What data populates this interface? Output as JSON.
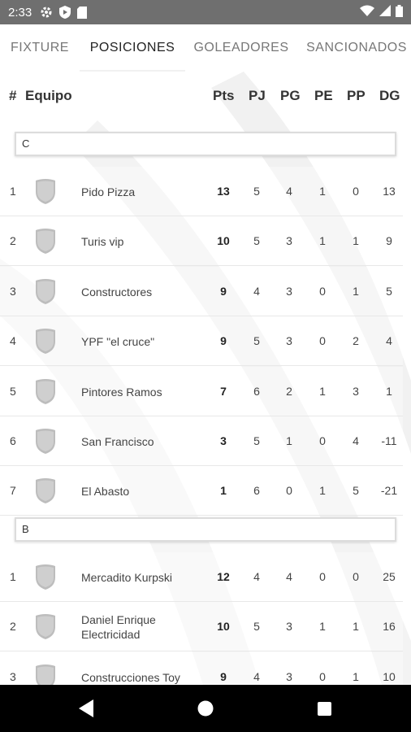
{
  "status": {
    "time": "2:33"
  },
  "tabs": [
    "FIXTURE",
    "POSICIONES",
    "GOLEADORES",
    "SANCIONADOS"
  ],
  "columns": {
    "rank": "#",
    "team": "Equipo",
    "pts": "Pts",
    "pj": "PJ",
    "pg": "PG",
    "pe": "PE",
    "pp": "PP",
    "dg": "DG"
  },
  "groups": [
    {
      "name": "C",
      "rows": [
        {
          "pos": "1",
          "team": "Pido Pizza",
          "pts": "13",
          "pj": "5",
          "pg": "4",
          "pe": "1",
          "pp": "0",
          "dg": "13"
        },
        {
          "pos": "2",
          "team": "Turis vip",
          "pts": "10",
          "pj": "5",
          "pg": "3",
          "pe": "1",
          "pp": "1",
          "dg": "9"
        },
        {
          "pos": "3",
          "team": "Constructores",
          "pts": "9",
          "pj": "4",
          "pg": "3",
          "pe": "0",
          "pp": "1",
          "dg": "5"
        },
        {
          "pos": "4",
          "team": "YPF \"el cruce\"",
          "pts": "9",
          "pj": "5",
          "pg": "3",
          "pe": "0",
          "pp": "2",
          "dg": "4"
        },
        {
          "pos": "5",
          "team": "Pintores Ramos",
          "pts": "7",
          "pj": "6",
          "pg": "2",
          "pe": "1",
          "pp": "3",
          "dg": "1"
        },
        {
          "pos": "6",
          "team": "San Francisco",
          "pts": "3",
          "pj": "5",
          "pg": "1",
          "pe": "0",
          "pp": "4",
          "dg": "-11"
        },
        {
          "pos": "7",
          "team": "El Abasto",
          "pts": "1",
          "pj": "6",
          "pg": "0",
          "pe": "1",
          "pp": "5",
          "dg": "-21"
        }
      ]
    },
    {
      "name": "B",
      "rows": [
        {
          "pos": "1",
          "team": "Mercadito Kurpski",
          "pts": "12",
          "pj": "4",
          "pg": "4",
          "pe": "0",
          "pp": "0",
          "dg": "25"
        },
        {
          "pos": "2",
          "team": "Daniel Enrique Electricidad",
          "pts": "10",
          "pj": "5",
          "pg": "3",
          "pe": "1",
          "pp": "1",
          "dg": "16"
        },
        {
          "pos": "3",
          "team": "Construcciones Toy",
          "pts": "9",
          "pj": "4",
          "pg": "3",
          "pe": "0",
          "pp": "1",
          "dg": "10"
        }
      ]
    }
  ]
}
